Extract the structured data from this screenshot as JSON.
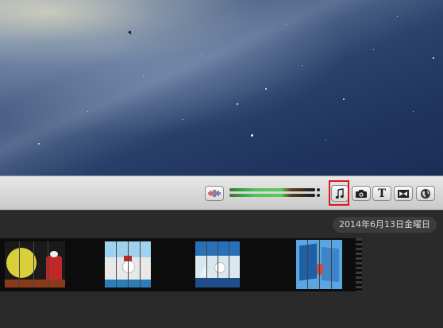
{
  "toolbar": {
    "audio_icon": "audio-waveform-icon",
    "music_icon": "music-note-icon",
    "camera_icon": "camera-icon",
    "title_icon": "title-T-icon",
    "transition_icon": "transition-icon",
    "map_icon": "globe-icon",
    "title_glyph": "T",
    "audio_meter_level": 0.62
  },
  "browser": {
    "date": "2014年6月13日金曜日",
    "clips": [
      {
        "id": "clip-1",
        "colors": [
          "#d8cf3a",
          "#c02828",
          "#1a1a1a"
        ]
      },
      {
        "id": "clip-2",
        "colors": [
          "#e8e8e8",
          "#77bde0",
          "#2a7db5"
        ]
      },
      {
        "id": "clip-3",
        "colors": [
          "#d9e8ef",
          "#2a70b8",
          "#1d4f8f"
        ]
      },
      {
        "id": "clip-4",
        "colors": [
          "#5aa6e0",
          "#1f5fa6",
          "#d24b3a"
        ]
      }
    ]
  },
  "colors": {
    "highlight": "#e0141a",
    "toolbar_top": "#e8e8e8",
    "toolbar_bottom": "#c9c9c9",
    "browser_bg": "#2a2a2a"
  }
}
